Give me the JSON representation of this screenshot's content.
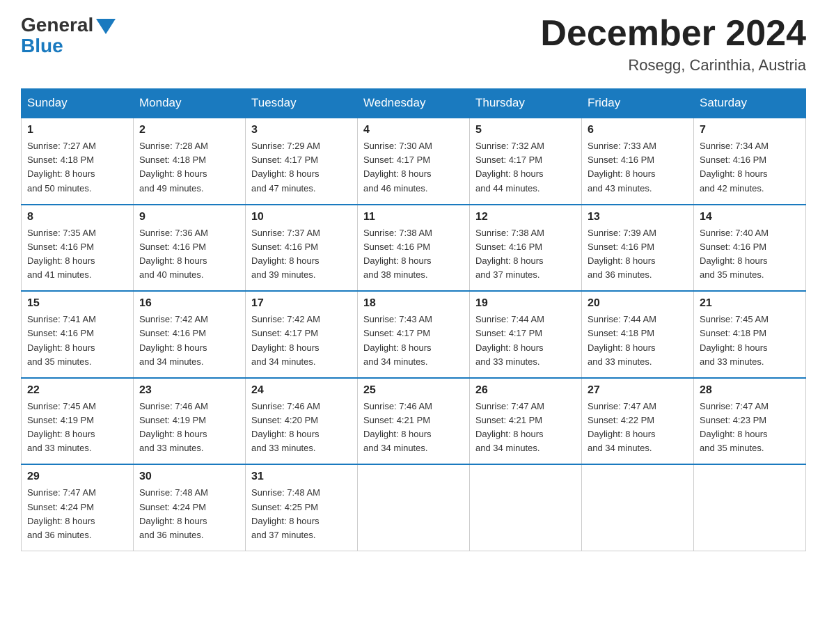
{
  "header": {
    "logo_general": "General",
    "logo_blue": "Blue",
    "month_title": "December 2024",
    "location": "Rosegg, Carinthia, Austria"
  },
  "days_of_week": [
    "Sunday",
    "Monday",
    "Tuesday",
    "Wednesday",
    "Thursday",
    "Friday",
    "Saturday"
  ],
  "weeks": [
    [
      {
        "day": "1",
        "sunrise": "7:27 AM",
        "sunset": "4:18 PM",
        "daylight": "8 hours and 50 minutes."
      },
      {
        "day": "2",
        "sunrise": "7:28 AM",
        "sunset": "4:18 PM",
        "daylight": "8 hours and 49 minutes."
      },
      {
        "day": "3",
        "sunrise": "7:29 AM",
        "sunset": "4:17 PM",
        "daylight": "8 hours and 47 minutes."
      },
      {
        "day": "4",
        "sunrise": "7:30 AM",
        "sunset": "4:17 PM",
        "daylight": "8 hours and 46 minutes."
      },
      {
        "day": "5",
        "sunrise": "7:32 AM",
        "sunset": "4:17 PM",
        "daylight": "8 hours and 44 minutes."
      },
      {
        "day": "6",
        "sunrise": "7:33 AM",
        "sunset": "4:16 PM",
        "daylight": "8 hours and 43 minutes."
      },
      {
        "day": "7",
        "sunrise": "7:34 AM",
        "sunset": "4:16 PM",
        "daylight": "8 hours and 42 minutes."
      }
    ],
    [
      {
        "day": "8",
        "sunrise": "7:35 AM",
        "sunset": "4:16 PM",
        "daylight": "8 hours and 41 minutes."
      },
      {
        "day": "9",
        "sunrise": "7:36 AM",
        "sunset": "4:16 PM",
        "daylight": "8 hours and 40 minutes."
      },
      {
        "day": "10",
        "sunrise": "7:37 AM",
        "sunset": "4:16 PM",
        "daylight": "8 hours and 39 minutes."
      },
      {
        "day": "11",
        "sunrise": "7:38 AM",
        "sunset": "4:16 PM",
        "daylight": "8 hours and 38 minutes."
      },
      {
        "day": "12",
        "sunrise": "7:38 AM",
        "sunset": "4:16 PM",
        "daylight": "8 hours and 37 minutes."
      },
      {
        "day": "13",
        "sunrise": "7:39 AM",
        "sunset": "4:16 PM",
        "daylight": "8 hours and 36 minutes."
      },
      {
        "day": "14",
        "sunrise": "7:40 AM",
        "sunset": "4:16 PM",
        "daylight": "8 hours and 35 minutes."
      }
    ],
    [
      {
        "day": "15",
        "sunrise": "7:41 AM",
        "sunset": "4:16 PM",
        "daylight": "8 hours and 35 minutes."
      },
      {
        "day": "16",
        "sunrise": "7:42 AM",
        "sunset": "4:16 PM",
        "daylight": "8 hours and 34 minutes."
      },
      {
        "day": "17",
        "sunrise": "7:42 AM",
        "sunset": "4:17 PM",
        "daylight": "8 hours and 34 minutes."
      },
      {
        "day": "18",
        "sunrise": "7:43 AM",
        "sunset": "4:17 PM",
        "daylight": "8 hours and 34 minutes."
      },
      {
        "day": "19",
        "sunrise": "7:44 AM",
        "sunset": "4:17 PM",
        "daylight": "8 hours and 33 minutes."
      },
      {
        "day": "20",
        "sunrise": "7:44 AM",
        "sunset": "4:18 PM",
        "daylight": "8 hours and 33 minutes."
      },
      {
        "day": "21",
        "sunrise": "7:45 AM",
        "sunset": "4:18 PM",
        "daylight": "8 hours and 33 minutes."
      }
    ],
    [
      {
        "day": "22",
        "sunrise": "7:45 AM",
        "sunset": "4:19 PM",
        "daylight": "8 hours and 33 minutes."
      },
      {
        "day": "23",
        "sunrise": "7:46 AM",
        "sunset": "4:19 PM",
        "daylight": "8 hours and 33 minutes."
      },
      {
        "day": "24",
        "sunrise": "7:46 AM",
        "sunset": "4:20 PM",
        "daylight": "8 hours and 33 minutes."
      },
      {
        "day": "25",
        "sunrise": "7:46 AM",
        "sunset": "4:21 PM",
        "daylight": "8 hours and 34 minutes."
      },
      {
        "day": "26",
        "sunrise": "7:47 AM",
        "sunset": "4:21 PM",
        "daylight": "8 hours and 34 minutes."
      },
      {
        "day": "27",
        "sunrise": "7:47 AM",
        "sunset": "4:22 PM",
        "daylight": "8 hours and 34 minutes."
      },
      {
        "day": "28",
        "sunrise": "7:47 AM",
        "sunset": "4:23 PM",
        "daylight": "8 hours and 35 minutes."
      }
    ],
    [
      {
        "day": "29",
        "sunrise": "7:47 AM",
        "sunset": "4:24 PM",
        "daylight": "8 hours and 36 minutes."
      },
      {
        "day": "30",
        "sunrise": "7:48 AM",
        "sunset": "4:24 PM",
        "daylight": "8 hours and 36 minutes."
      },
      {
        "day": "31",
        "sunrise": "7:48 AM",
        "sunset": "4:25 PM",
        "daylight": "8 hours and 37 minutes."
      },
      null,
      null,
      null,
      null
    ]
  ],
  "labels": {
    "sunrise": "Sunrise:",
    "sunset": "Sunset:",
    "daylight": "Daylight:"
  }
}
